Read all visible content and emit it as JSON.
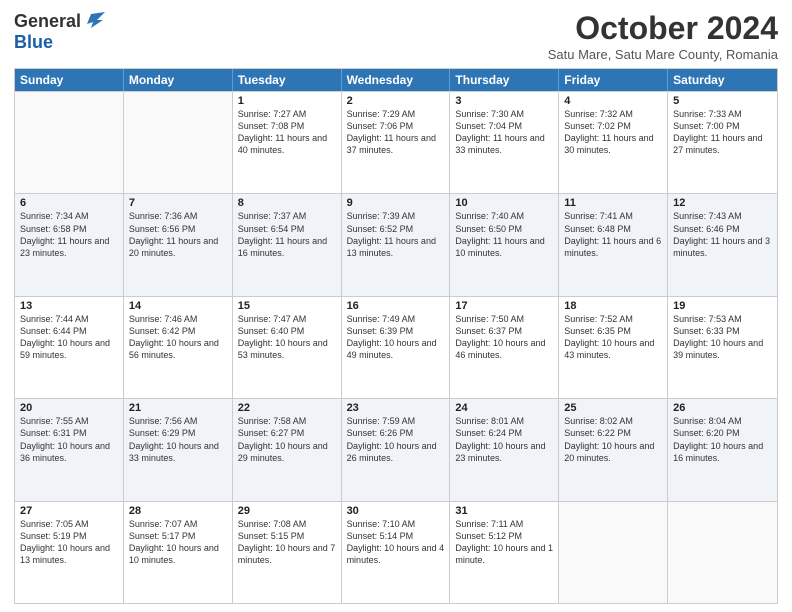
{
  "header": {
    "logo_general": "General",
    "logo_blue": "Blue",
    "month_title": "October 2024",
    "subtitle": "Satu Mare, Satu Mare County, Romania"
  },
  "weekdays": [
    "Sunday",
    "Monday",
    "Tuesday",
    "Wednesday",
    "Thursday",
    "Friday",
    "Saturday"
  ],
  "rows": [
    [
      {
        "day": "",
        "info": ""
      },
      {
        "day": "",
        "info": ""
      },
      {
        "day": "1",
        "info": "Sunrise: 7:27 AM\nSunset: 7:08 PM\nDaylight: 11 hours and 40 minutes."
      },
      {
        "day": "2",
        "info": "Sunrise: 7:29 AM\nSunset: 7:06 PM\nDaylight: 11 hours and 37 minutes."
      },
      {
        "day": "3",
        "info": "Sunrise: 7:30 AM\nSunset: 7:04 PM\nDaylight: 11 hours and 33 minutes."
      },
      {
        "day": "4",
        "info": "Sunrise: 7:32 AM\nSunset: 7:02 PM\nDaylight: 11 hours and 30 minutes."
      },
      {
        "day": "5",
        "info": "Sunrise: 7:33 AM\nSunset: 7:00 PM\nDaylight: 11 hours and 27 minutes."
      }
    ],
    [
      {
        "day": "6",
        "info": "Sunrise: 7:34 AM\nSunset: 6:58 PM\nDaylight: 11 hours and 23 minutes."
      },
      {
        "day": "7",
        "info": "Sunrise: 7:36 AM\nSunset: 6:56 PM\nDaylight: 11 hours and 20 minutes."
      },
      {
        "day": "8",
        "info": "Sunrise: 7:37 AM\nSunset: 6:54 PM\nDaylight: 11 hours and 16 minutes."
      },
      {
        "day": "9",
        "info": "Sunrise: 7:39 AM\nSunset: 6:52 PM\nDaylight: 11 hours and 13 minutes."
      },
      {
        "day": "10",
        "info": "Sunrise: 7:40 AM\nSunset: 6:50 PM\nDaylight: 11 hours and 10 minutes."
      },
      {
        "day": "11",
        "info": "Sunrise: 7:41 AM\nSunset: 6:48 PM\nDaylight: 11 hours and 6 minutes."
      },
      {
        "day": "12",
        "info": "Sunrise: 7:43 AM\nSunset: 6:46 PM\nDaylight: 11 hours and 3 minutes."
      }
    ],
    [
      {
        "day": "13",
        "info": "Sunrise: 7:44 AM\nSunset: 6:44 PM\nDaylight: 10 hours and 59 minutes."
      },
      {
        "day": "14",
        "info": "Sunrise: 7:46 AM\nSunset: 6:42 PM\nDaylight: 10 hours and 56 minutes."
      },
      {
        "day": "15",
        "info": "Sunrise: 7:47 AM\nSunset: 6:40 PM\nDaylight: 10 hours and 53 minutes."
      },
      {
        "day": "16",
        "info": "Sunrise: 7:49 AM\nSunset: 6:39 PM\nDaylight: 10 hours and 49 minutes."
      },
      {
        "day": "17",
        "info": "Sunrise: 7:50 AM\nSunset: 6:37 PM\nDaylight: 10 hours and 46 minutes."
      },
      {
        "day": "18",
        "info": "Sunrise: 7:52 AM\nSunset: 6:35 PM\nDaylight: 10 hours and 43 minutes."
      },
      {
        "day": "19",
        "info": "Sunrise: 7:53 AM\nSunset: 6:33 PM\nDaylight: 10 hours and 39 minutes."
      }
    ],
    [
      {
        "day": "20",
        "info": "Sunrise: 7:55 AM\nSunset: 6:31 PM\nDaylight: 10 hours and 36 minutes."
      },
      {
        "day": "21",
        "info": "Sunrise: 7:56 AM\nSunset: 6:29 PM\nDaylight: 10 hours and 33 minutes."
      },
      {
        "day": "22",
        "info": "Sunrise: 7:58 AM\nSunset: 6:27 PM\nDaylight: 10 hours and 29 minutes."
      },
      {
        "day": "23",
        "info": "Sunrise: 7:59 AM\nSunset: 6:26 PM\nDaylight: 10 hours and 26 minutes."
      },
      {
        "day": "24",
        "info": "Sunrise: 8:01 AM\nSunset: 6:24 PM\nDaylight: 10 hours and 23 minutes."
      },
      {
        "day": "25",
        "info": "Sunrise: 8:02 AM\nSunset: 6:22 PM\nDaylight: 10 hours and 20 minutes."
      },
      {
        "day": "26",
        "info": "Sunrise: 8:04 AM\nSunset: 6:20 PM\nDaylight: 10 hours and 16 minutes."
      }
    ],
    [
      {
        "day": "27",
        "info": "Sunrise: 7:05 AM\nSunset: 5:19 PM\nDaylight: 10 hours and 13 minutes."
      },
      {
        "day": "28",
        "info": "Sunrise: 7:07 AM\nSunset: 5:17 PM\nDaylight: 10 hours and 10 minutes."
      },
      {
        "day": "29",
        "info": "Sunrise: 7:08 AM\nSunset: 5:15 PM\nDaylight: 10 hours and 7 minutes."
      },
      {
        "day": "30",
        "info": "Sunrise: 7:10 AM\nSunset: 5:14 PM\nDaylight: 10 hours and 4 minutes."
      },
      {
        "day": "31",
        "info": "Sunrise: 7:11 AM\nSunset: 5:12 PM\nDaylight: 10 hours and 1 minute."
      },
      {
        "day": "",
        "info": ""
      },
      {
        "day": "",
        "info": ""
      }
    ]
  ]
}
